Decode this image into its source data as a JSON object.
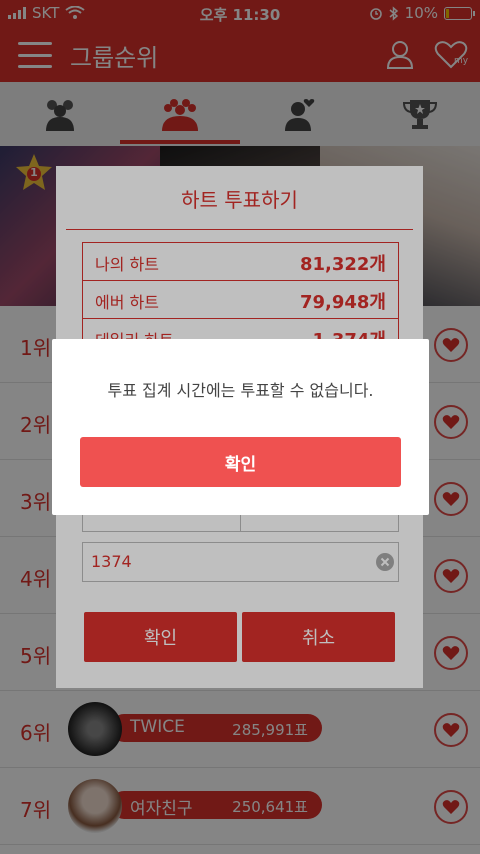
{
  "status": {
    "carrier": "SKT",
    "time": "오후 11:30",
    "battery": "10%"
  },
  "appbar": {
    "title": "그룹순위"
  },
  "tabs": [
    {
      "icon": "people-group-icon"
    },
    {
      "icon": "crowd-icon"
    },
    {
      "icon": "person-heart-icon"
    },
    {
      "icon": "trophy-icon"
    }
  ],
  "banner": {
    "badge": "1"
  },
  "list": [
    {
      "rank": "1위"
    },
    {
      "rank": "2위"
    },
    {
      "rank": "3위"
    },
    {
      "rank": "4위"
    },
    {
      "rank": "5위"
    },
    {
      "rank": "6위",
      "name": "TWICE",
      "votes": "285,991표"
    },
    {
      "rank": "7위",
      "name": "여자친구",
      "votes": "250,641표"
    }
  ],
  "vote_dialog": {
    "title": "하트 투표하기",
    "stats": [
      {
        "label": "나의 하트",
        "value": "81,322개"
      },
      {
        "label": "에버 하트",
        "value": "79,948개"
      },
      {
        "label": "데일리 하트",
        "value": "1,374개"
      }
    ],
    "input_value": "1374",
    "confirm": "확인",
    "cancel": "취소"
  },
  "alert": {
    "message": "투표 집계 시간에는 투표할 수 없습니다.",
    "ok": "확인"
  },
  "colors": {
    "brand": "#d8312c",
    "alert_button": "#ef5150"
  }
}
